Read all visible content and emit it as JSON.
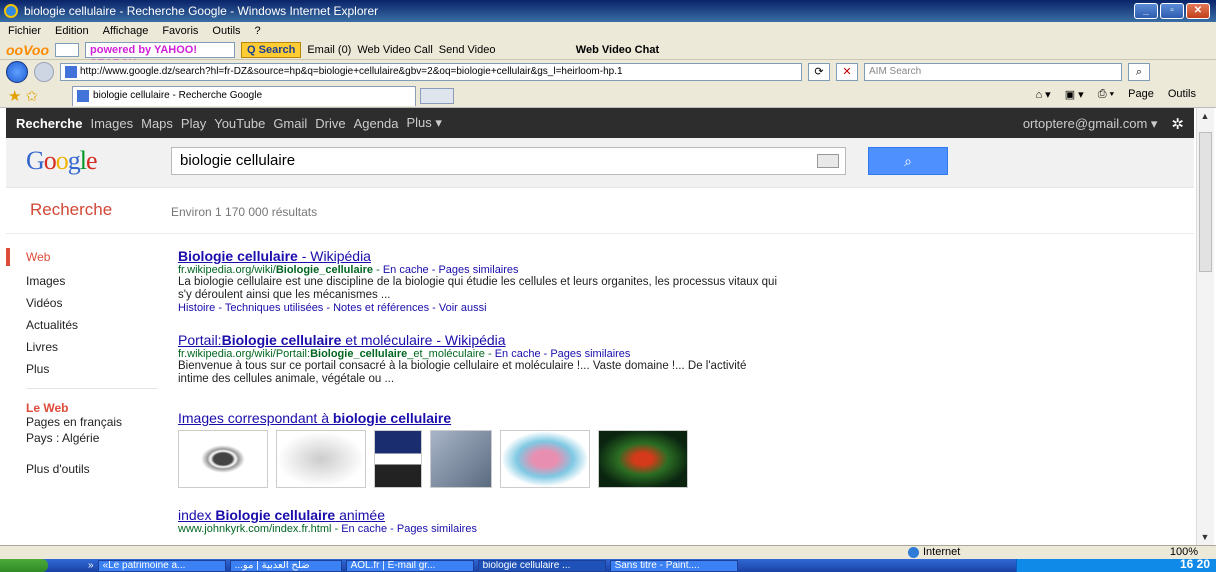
{
  "window": {
    "title": "biologie cellulaire - Recherche Google - Windows Internet Explorer",
    "menu": [
      "Fichier",
      "Edition",
      "Affichage",
      "Favoris",
      "Outils",
      "?"
    ]
  },
  "toolbar": {
    "brand": "ooVoo",
    "yahoo": "powered by YAHOO! SEARCH",
    "search_button": "Q Search",
    "email": "Email (0)",
    "web_video_call": "Web Video Call",
    "send_video": "Send Video",
    "web_video_chat": "Web Video Chat"
  },
  "address": {
    "url": "http://www.google.dz/search?hl=fr-DZ&source=hp&q=biologie+cellulaire&gbv=2&oq=biologie+cellulair&gs_l=heirloom-hp.1",
    "aim_placeholder": "AIM Search"
  },
  "tab": {
    "label": "biologie cellulaire - Recherche Google"
  },
  "command_bar": {
    "page": "Page",
    "tools": "Outils"
  },
  "gbar": {
    "items": [
      "Recherche",
      "Images",
      "Maps",
      "Play",
      "YouTube",
      "Gmail",
      "Drive",
      "Agenda",
      "Plus ▾"
    ],
    "account": "ortoptere@gmail.com ▾"
  },
  "search": {
    "query": "biologie cellulaire"
  },
  "subheader": {
    "title": "Recherche",
    "stats": "Environ 1 170 000 résultats"
  },
  "leftnav": {
    "items": [
      "Web",
      "Images",
      "Vidéos",
      "Actualités",
      "Livres",
      "Plus"
    ],
    "section_title": "Le Web",
    "section_items": [
      "Pages en français",
      "Pays : Algérie"
    ],
    "more_tools": "Plus d'outils"
  },
  "results": [
    {
      "title_pre": "",
      "title_bold": "Biologie cellulaire",
      "title_post": " - Wikipédia",
      "url_pre": "fr.wikipedia.org/wiki/",
      "url_bold": "Biologie_cellulaire",
      "url_post": "",
      "url_links": "En cache - Pages similaires",
      "snippet": "La biologie cellulaire est une discipline de la biologie qui étudie les cellules et leurs organites, les processus vitaux qui s'y déroulent ainsi que les mécanismes ...",
      "links": "Histoire - Techniques utilisées - Notes et références - Voir aussi"
    },
    {
      "title_pre": "Portail:",
      "title_bold": "Biologie cellulaire",
      "title_post": " et moléculaire - Wikipédia",
      "url_pre": "fr.wikipedia.org/wiki/Portail:",
      "url_bold": "Biologie_cellulaire",
      "url_post": "_et_moléculaire",
      "url_links": "En cache - Pages similaires",
      "snippet": "Bienvenue à tous sur ce portail consacré à la biologie cellulaire et moléculaire !... Vaste domaine !... De l'activité intime des cellules animale, végétale ou ...",
      "links": ""
    }
  ],
  "images_block": {
    "title_pre": "Images correspondant à ",
    "title_bold": "biologie cellulaire"
  },
  "result3": {
    "title_pre": "index ",
    "title_bold": "Biologie cellulaire",
    "title_post": " animée",
    "url": "www.johnkyrk.com/index.fr.html",
    "url_links": "En cache - Pages similaires"
  },
  "status": {
    "zone": "Internet",
    "zoom": "100%"
  },
  "taskbar": {
    "tasks": [
      "«Le patrimoine a...",
      "...ضلح العدبية | مو",
      "AOL.fr | E-mail gr...",
      "biologie cellulaire ...",
      "Sans titre - Paint...."
    ],
    "clock": "16 20"
  }
}
